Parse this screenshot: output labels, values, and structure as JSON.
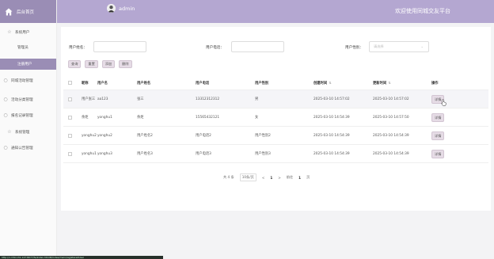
{
  "sidebar": {
    "brand": "后台首页",
    "menu": [
      {
        "label": "系统用户",
        "icon": "star-icon"
      },
      {
        "label": "同城活动管理",
        "icon": "circle-icon"
      },
      {
        "label": "活动分类管理",
        "icon": "circle-icon"
      },
      {
        "label": "报名记录管理",
        "icon": "circle-icon"
      },
      {
        "label": "系统管理",
        "icon": "star-icon"
      },
      {
        "label": "通知公告管理",
        "icon": "circle-icon"
      }
    ],
    "submenu": [
      {
        "label": "管理员"
      },
      {
        "label": "注册用户"
      }
    ]
  },
  "header": {
    "username": "admin",
    "welcome": "欢迎使用同城交友平台"
  },
  "search": {
    "name_label": "用户姓名：",
    "name_value": "",
    "phone_label": "用户电话：",
    "phone_value": "",
    "gender_label": "用户性别：",
    "gender_placeholder": "请选择"
  },
  "buttons": {
    "query": "查询",
    "reset": "重置",
    "add": "添加",
    "delete": "删除"
  },
  "table": {
    "headers": [
      "昵称",
      "用户名",
      "用户姓名",
      "用户电话",
      "用户性别",
      "创建时间",
      "更新时间",
      "操作"
    ],
    "rows": [
      {
        "nickname": "用户张三",
        "username": "aa123",
        "realname": "张三",
        "phone": "13312312312",
        "gender": "男",
        "created": "2025-03-10 14:57:02",
        "updated": "2025-03-10 14:57:02",
        "action": "详情"
      },
      {
        "nickname": "余炬",
        "username": "yonghu1",
        "realname": "余炬",
        "phone": "15565432121",
        "gender": "女",
        "created": "2025-03-10 14:54:39",
        "updated": "2025-03-10 14:57:50",
        "action": "详情"
      },
      {
        "nickname": "yonghu2",
        "username": "yonghu2",
        "realname": "用户姓名2",
        "phone": "用户电话2",
        "gender": "用户性别2",
        "created": "2025-03-10 14:54:39",
        "updated": "2025-03-10 14:54:39",
        "action": "详情"
      },
      {
        "nickname": "yonghu1",
        "username": "yonghu3",
        "realname": "用户姓名3",
        "phone": "用户电话3",
        "gender": "用户性别3",
        "created": "2025-03-10 14:54:39",
        "updated": "2025-03-10 14:54:39",
        "action": "详情"
      }
    ]
  },
  "pager": {
    "total": "共 4 条",
    "size": "10条/页",
    "prev": "<",
    "page": "1",
    "next": ">",
    "goto": "前往",
    "goto_value": "1",
    "page_suffix": "页"
  },
  "statusbar": {
    "text": "http://1.159.131.147:8077/fe/index.html#/index/main/registeredUser"
  },
  "colors": {
    "brand": "#9a8db5",
    "header": "#b4a7d1",
    "button": "#e6dce6"
  }
}
